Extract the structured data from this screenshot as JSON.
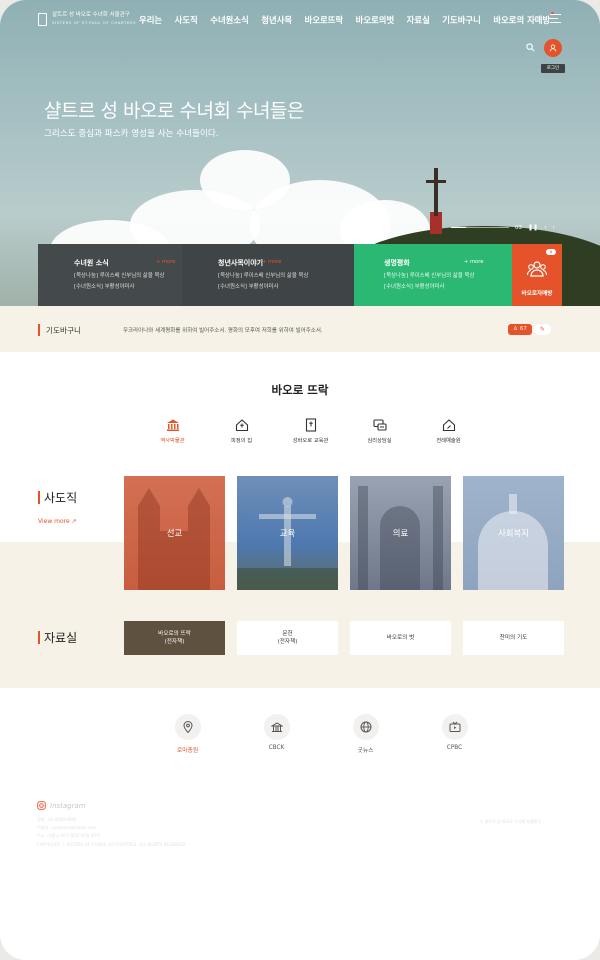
{
  "header": {
    "logo_name": "샬트르 성 바오로 수녀회 서울관구",
    "logo_sub": "SISTERS OF ST.PAUL OF CHARTRES",
    "nav": [
      "우리는",
      "사도직",
      "수녀원소식",
      "청년사목",
      "바오로뜨락",
      "바오로의벗",
      "자료실",
      "기도바구니",
      "바오로의 자매방"
    ],
    "login_label": "로그인"
  },
  "hero": {
    "title": "샬트르 성 바오로 수녀회 수녀들은",
    "subtitle": "그리스도 중심과 파스카 영성을 사는 수녀들이다.",
    "slide_total": "03",
    "slide_progress": 0.25
  },
  "cards": [
    {
      "title": "수녀원 소식",
      "more": "+ more",
      "lines": [
        "[묵상나눔] 루이스베 신부님의 삶을 묵상",
        "[수녀원소식] 부활성야미사"
      ]
    },
    {
      "title": "청년사목이야기",
      "more": "+ more",
      "lines": [
        "[묵상나눔] 루이스베 신부님의 삶을 묵상",
        "[수녀원소식] 부활성야미사"
      ]
    },
    {
      "title": "생명평화",
      "more": "+ more",
      "lines": [
        "[묵상나눔] 루이스베 신부님의 삶을 묵상",
        "[수녀원소식] 부활성야미사"
      ]
    }
  ],
  "donate": {
    "label": "바오로자매방",
    "badge": "N"
  },
  "prayer": {
    "title": "기도바구니",
    "text": "우크라이나와 세계평화를 위하여 빌어주소서. 평화의 모후여 저희를 위하여 빌어주소서.",
    "count": "67"
  },
  "paul": {
    "title": "바오로 뜨락",
    "tabs": [
      "역사박물관",
      "피정의 집",
      "성바오로 교육관",
      "심리상담실",
      "전례예술원"
    ],
    "active_tab": 0
  },
  "apostolate": {
    "title": "사도직",
    "more": "View more ↗",
    "tiles": [
      "선교",
      "교육",
      "의료",
      "사회복지"
    ]
  },
  "archive": {
    "title": "자료실",
    "items": [
      "바오로의 뜨락\n(전자책)",
      "문헌\n(전자책)",
      "바오로의 벗",
      "찬미의 기도"
    ]
  },
  "links": {
    "items": [
      "로마총원",
      "CBCK",
      "굿뉴스",
      "CPBC"
    ],
    "active": 0
  },
  "footer": {
    "instagram": "Instagram",
    "lines": [
      "전화 : 02-0000-0000",
      "이메일 : spcbaninf@naver.com",
      "주소 : 서울시 00구 00로 00길 00-0",
      "COPYRIGHT ⓒ SISTERS OF ST.PAUL OF CHARTRES. ALL RIGHTS RESERVED."
    ],
    "logo_name": "샬트르 성 바오로 수녀회 서울관구"
  },
  "colors": {
    "accent": "#e5532a",
    "green": "#2bb872",
    "dark": "#444a4b",
    "cream": "#f7f2e8"
  }
}
